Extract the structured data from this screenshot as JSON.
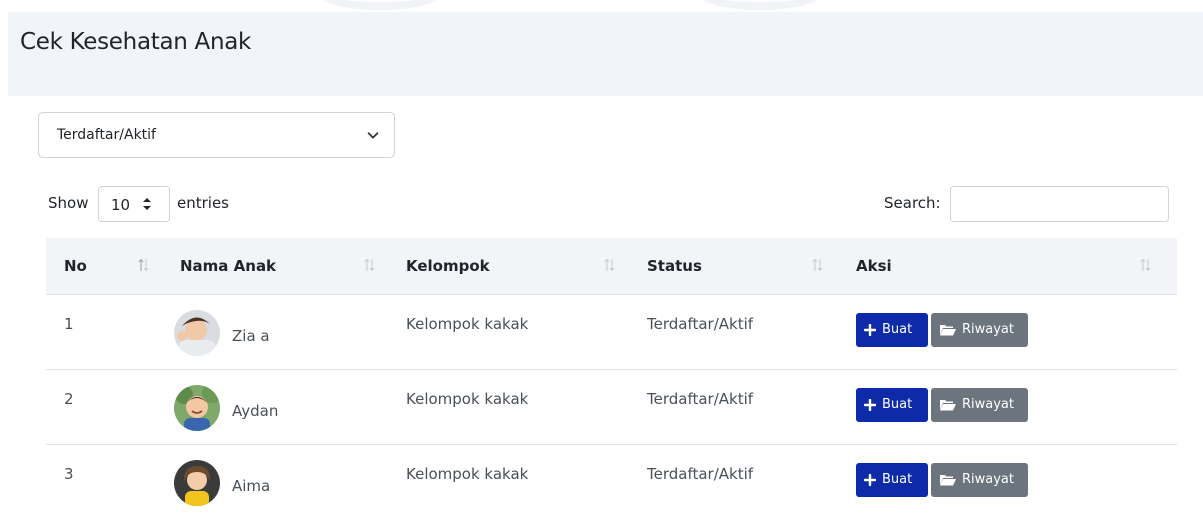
{
  "page": {
    "title": "Cek Kesehatan Anak"
  },
  "filter": {
    "selected": "Terdaftar/Aktif"
  },
  "length": {
    "show_label": "Show",
    "value": "10",
    "entries_label": "entries"
  },
  "search": {
    "label": "Search:",
    "value": ""
  },
  "table": {
    "headers": [
      "No",
      "Nama Anak",
      "Kelompok",
      "Status",
      "Aksi"
    ],
    "rows": [
      {
        "no": "1",
        "name": "Zia a",
        "kelompok": "Kelompok kakak",
        "status": "Terdaftar/Aktif"
      },
      {
        "no": "2",
        "name": "Aydan",
        "kelompok": "Kelompok kakak",
        "status": "Terdaftar/Aktif"
      },
      {
        "no": "3",
        "name": "Aima",
        "kelompok": "Kelompok kakak",
        "status": "Terdaftar/Aktif"
      }
    ],
    "actions": {
      "create_label": "Buat",
      "history_label": "Riwayat"
    }
  },
  "colors": {
    "primary": "#0d2aa8",
    "secondary": "#6c757d",
    "header_bg": "#f1f4f9"
  },
  "icons": {
    "create": "plus-icon",
    "history": "folder-open-icon",
    "sort": "sort-icon",
    "dropdown": "chevron-down-icon"
  }
}
